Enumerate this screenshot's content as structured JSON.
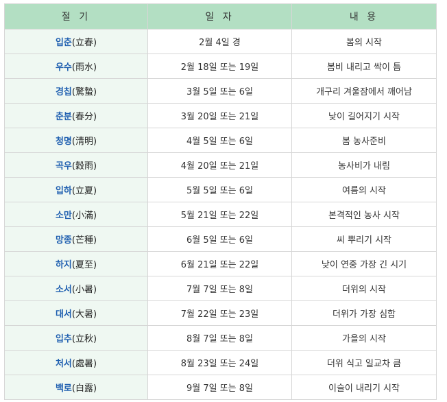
{
  "table": {
    "headers": [
      "절 기",
      "일 자",
      "내 용"
    ],
    "rows": [
      {
        "term": "입춘",
        "hanja": "(立春)",
        "date": "2월 4일 경",
        "desc": "봄의 시작"
      },
      {
        "term": "우수",
        "hanja": "(雨水)",
        "date": "2월 18일 또는 19일",
        "desc": "봄비 내리고 싹이 틈"
      },
      {
        "term": "경칩",
        "hanja": "(驚蟄)",
        "date": "3월 5일 또는 6일",
        "desc": "개구리 겨울잠에서 깨어남"
      },
      {
        "term": "춘분",
        "hanja": "(春分)",
        "date": "3월 20일 또는 21일",
        "desc": "낮이 길어지기 시작"
      },
      {
        "term": "청명",
        "hanja": "(淸明)",
        "date": "4월 5일 또는 6일",
        "desc": "봄 농사준비"
      },
      {
        "term": "곡우",
        "hanja": "(穀雨)",
        "date": "4월 20일 또는 21일",
        "desc": "농사비가 내림"
      },
      {
        "term": "입하",
        "hanja": "(立夏)",
        "date": "5월 5일 또는 6일",
        "desc": "여름의 시작"
      },
      {
        "term": "소만",
        "hanja": "(小滿)",
        "date": "5월 21일 또는 22일",
        "desc": "본격적인 농사 시작"
      },
      {
        "term": "망종",
        "hanja": "(芒種)",
        "date": "6월 5일 또는 6일",
        "desc": "씨 뿌리기 시작"
      },
      {
        "term": "하지",
        "hanja": "(夏至)",
        "date": "6월 21일 또는 22일",
        "desc": "낮이 연중 가장 긴 시기"
      },
      {
        "term": "소서",
        "hanja": "(小暑)",
        "date": "7월 7일 또는 8일",
        "desc": "더위의 시작"
      },
      {
        "term": "대서",
        "hanja": "(大暑)",
        "date": "7월 22일 또는 23일",
        "desc": "더위가 가장 심함"
      },
      {
        "term": "입추",
        "hanja": "(立秋)",
        "date": "8월 7일 또는 8일",
        "desc": "가을의 시작"
      },
      {
        "term": "처서",
        "hanja": "(處暑)",
        "date": "8월 23일 또는 24일",
        "desc": "더위 식고 일교차 큼"
      },
      {
        "term": "백로",
        "hanja": "(白露)",
        "date": "9월 7일 또는 8일",
        "desc": "이슬이 내리기 시작"
      }
    ]
  },
  "colors": {
    "header_bg": "#b3dfc3",
    "term_cell_bg": "#eff8f2",
    "term_text": "#1f5fb0",
    "border": "#d6d6d6"
  }
}
